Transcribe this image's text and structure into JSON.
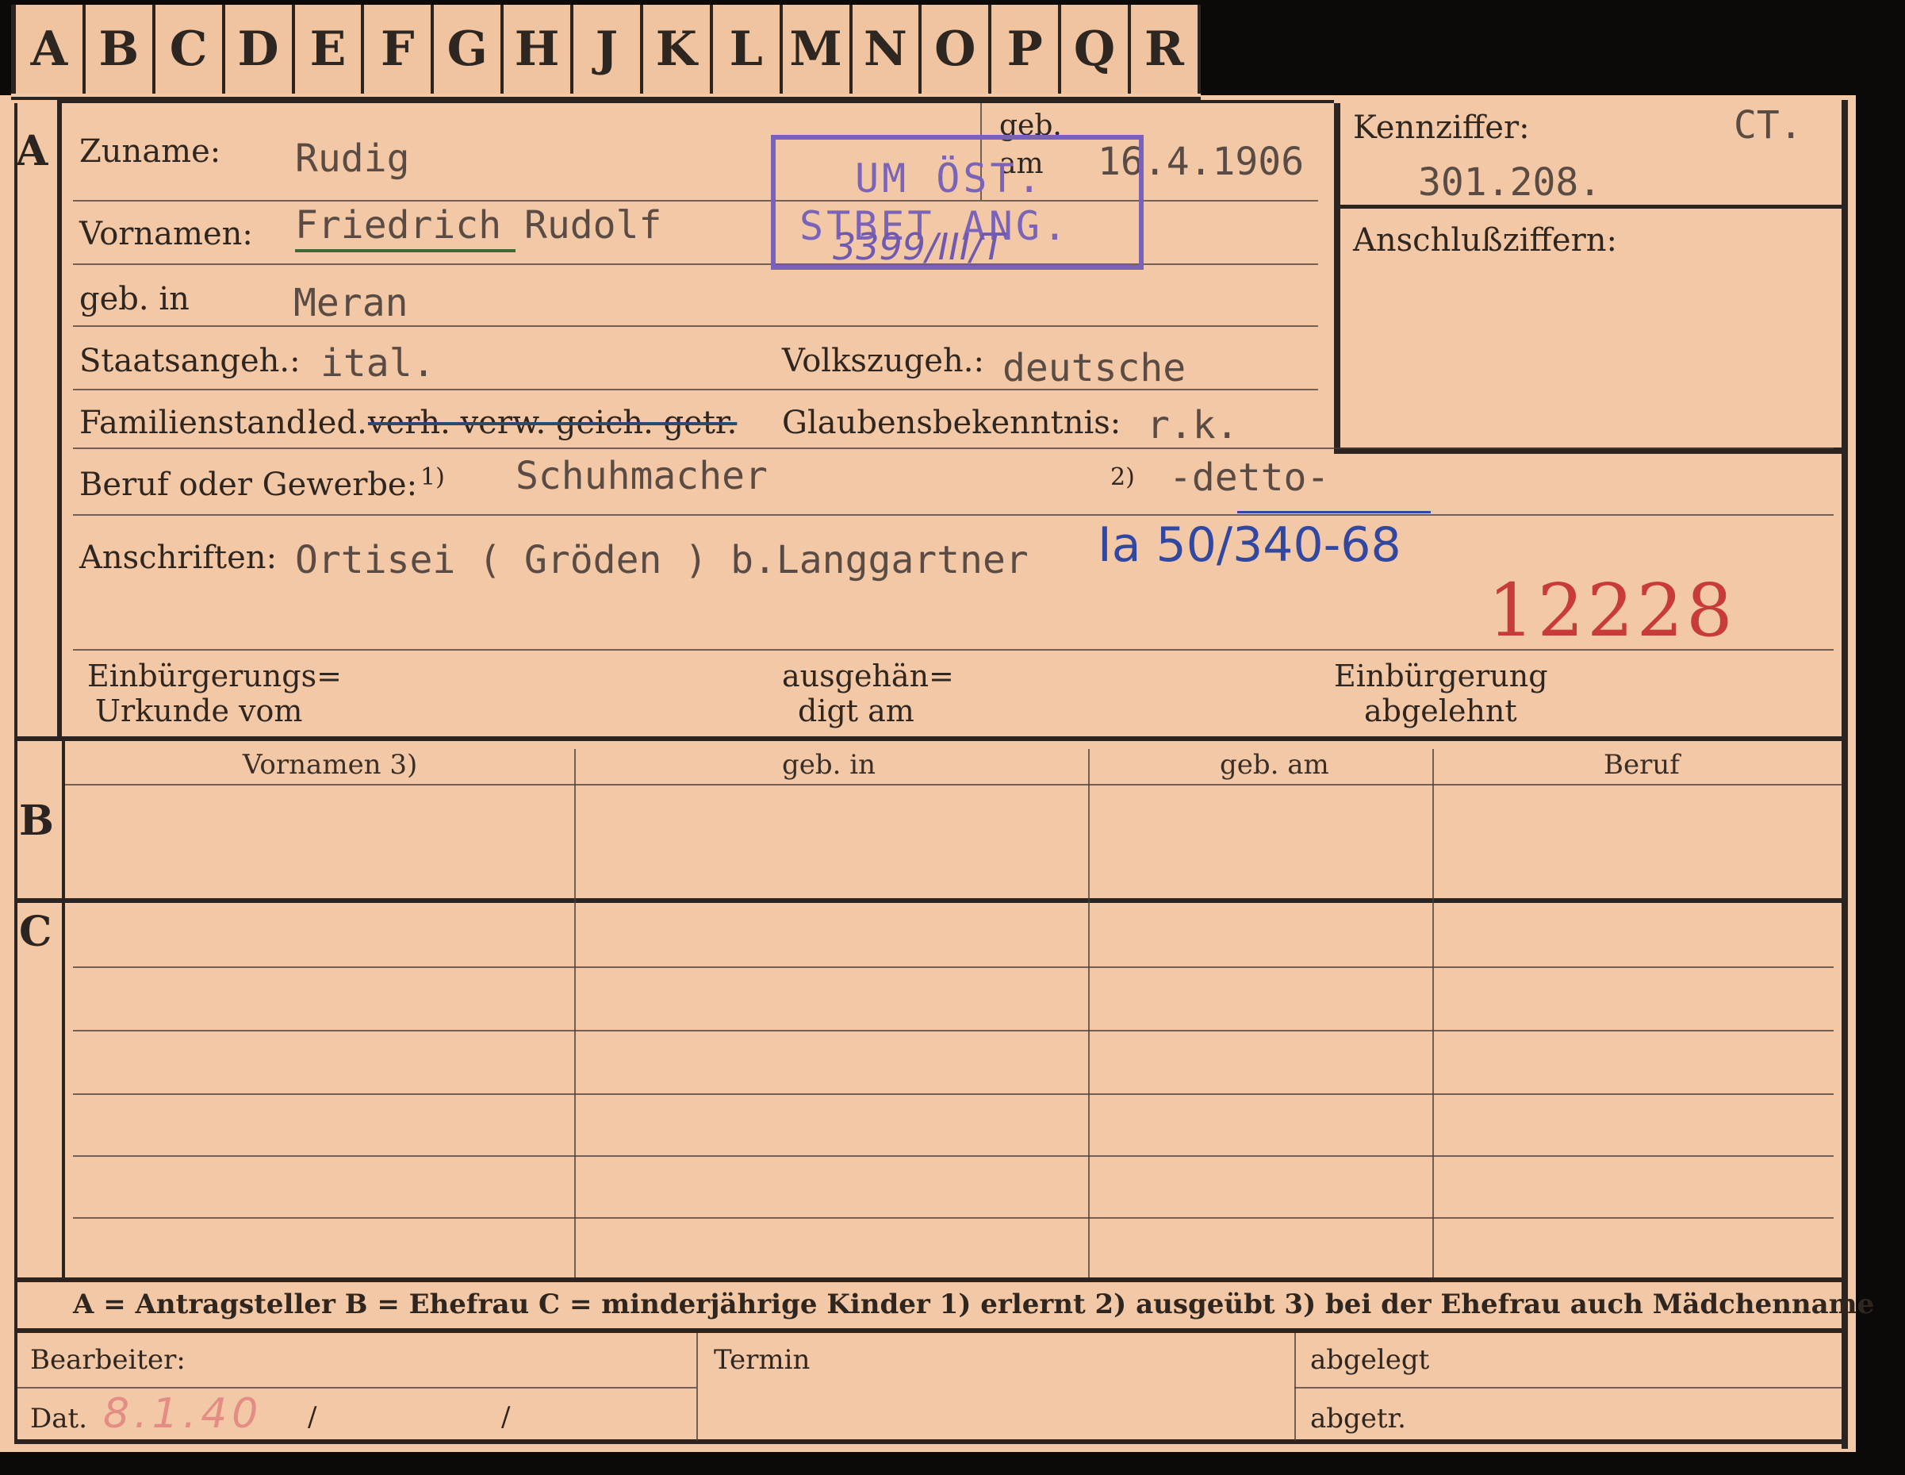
{
  "tabs": [
    "A",
    "B",
    "C",
    "D",
    "E",
    "F",
    "G",
    "H",
    "J",
    "K",
    "L",
    "M",
    "N",
    "O",
    "P",
    "Q",
    "R"
  ],
  "sections": {
    "a": "A",
    "b": "B",
    "c": "C"
  },
  "labels": {
    "zuname": "Zuname:",
    "vornamen": "Vornamen:",
    "geb_in": "geb. in",
    "geb_am_1": "geb.",
    "geb_am_2": "am",
    "staatsangeh": "Staatsangeh.:",
    "volkszugeh": "Volkszugeh.:",
    "familienstand": "Familienstand:",
    "fam_led": "led.",
    "fam_struck": "verh. verw. geich. getr.",
    "glaubensbekenntnis": "Glaubensbekenntnis:",
    "beruf": "Beruf oder Gewerbe:",
    "beruf_note1": "1)",
    "beruf_note2": "2)",
    "anschriften": "Anschriften:",
    "einb_1": "Einbürgerungs=",
    "einb_2": "Urkunde vom",
    "ausg_1": "ausgehän=",
    "ausg_2": "digt am",
    "abgelehnt_1": "Einbürgerung",
    "abgelehnt_2": "abgelehnt",
    "kennziffer": "Kennziffer:",
    "anschlussziffern": "Anschlußziffern:"
  },
  "values": {
    "zuname": "Rudig",
    "vornamen": "Friedrich Rudolf",
    "geb_in": "Meran",
    "geb_am": "16.4.1906",
    "staatsangeh": "ital.",
    "volkszugeh": "deutsche",
    "glaubensbekenntnis": "r.k.",
    "beruf_erlernt": "Schuhmacher",
    "beruf_ausgeuebt": "-detto-",
    "anschrift": "Ortisei ( Gröden ) b.Langgartner",
    "kennziffer_prefix": "CT.",
    "kennziffer": "301.208."
  },
  "annotations": {
    "stamp_line1": "UM ÖST.",
    "stamp_line2": "STBET ANG.",
    "stamp_handwritten": "3399/III/T",
    "blue_handwritten": "Ia 50/340-68",
    "red_number": "12228",
    "pencil_date": "8.1.40"
  },
  "table_headers": [
    "Vornamen 3)",
    "geb. in",
    "geb. am",
    "Beruf"
  ],
  "legend": "A = Antragsteller   B = Ehefrau   C = minderjährige Kinder   1) erlernt   2) ausgeübt   3) bei der Ehefrau auch Mädchenname",
  "footer": {
    "bearbeiter": "Bearbeiter:",
    "dat": "Dat.",
    "slash": "/",
    "termin": "Termin",
    "abgelegt": "abgelegt",
    "abgetr": "abgetr."
  }
}
